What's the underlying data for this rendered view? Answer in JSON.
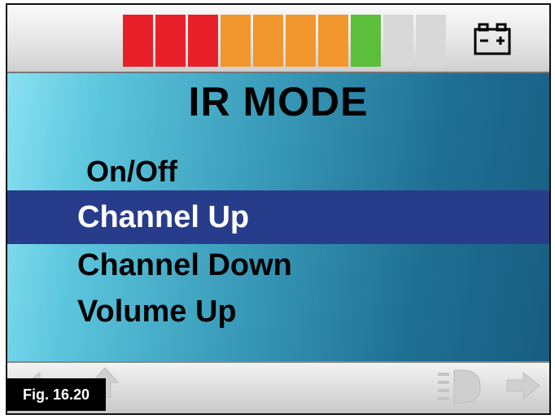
{
  "status": {
    "battery_segments": [
      {
        "color": "#e8202a"
      },
      {
        "color": "#e8202a"
      },
      {
        "color": "#e8202a"
      },
      {
        "color": "#f2962e"
      },
      {
        "color": "#f2962e"
      },
      {
        "color": "#f2962e"
      },
      {
        "color": "#f2962e"
      },
      {
        "color": "#5cbf3c"
      },
      {
        "color": "#d8d8d8"
      },
      {
        "color": "#d8d8d8"
      }
    ],
    "battery_icon": "battery-icon"
  },
  "screen": {
    "title": "IR MODE",
    "menu": {
      "items": [
        "On/Off",
        "Channel Up",
        "Channel Down",
        "Volume Up"
      ],
      "selected": "Channel Up",
      "highlight_color": "#283c8c"
    }
  },
  "bottom": {
    "icons": [
      "left-arrow-icon",
      "up-arrow-icon",
      "lights-icon",
      "right-arrow-icon"
    ]
  },
  "figure_label": "Fig. 16.20"
}
